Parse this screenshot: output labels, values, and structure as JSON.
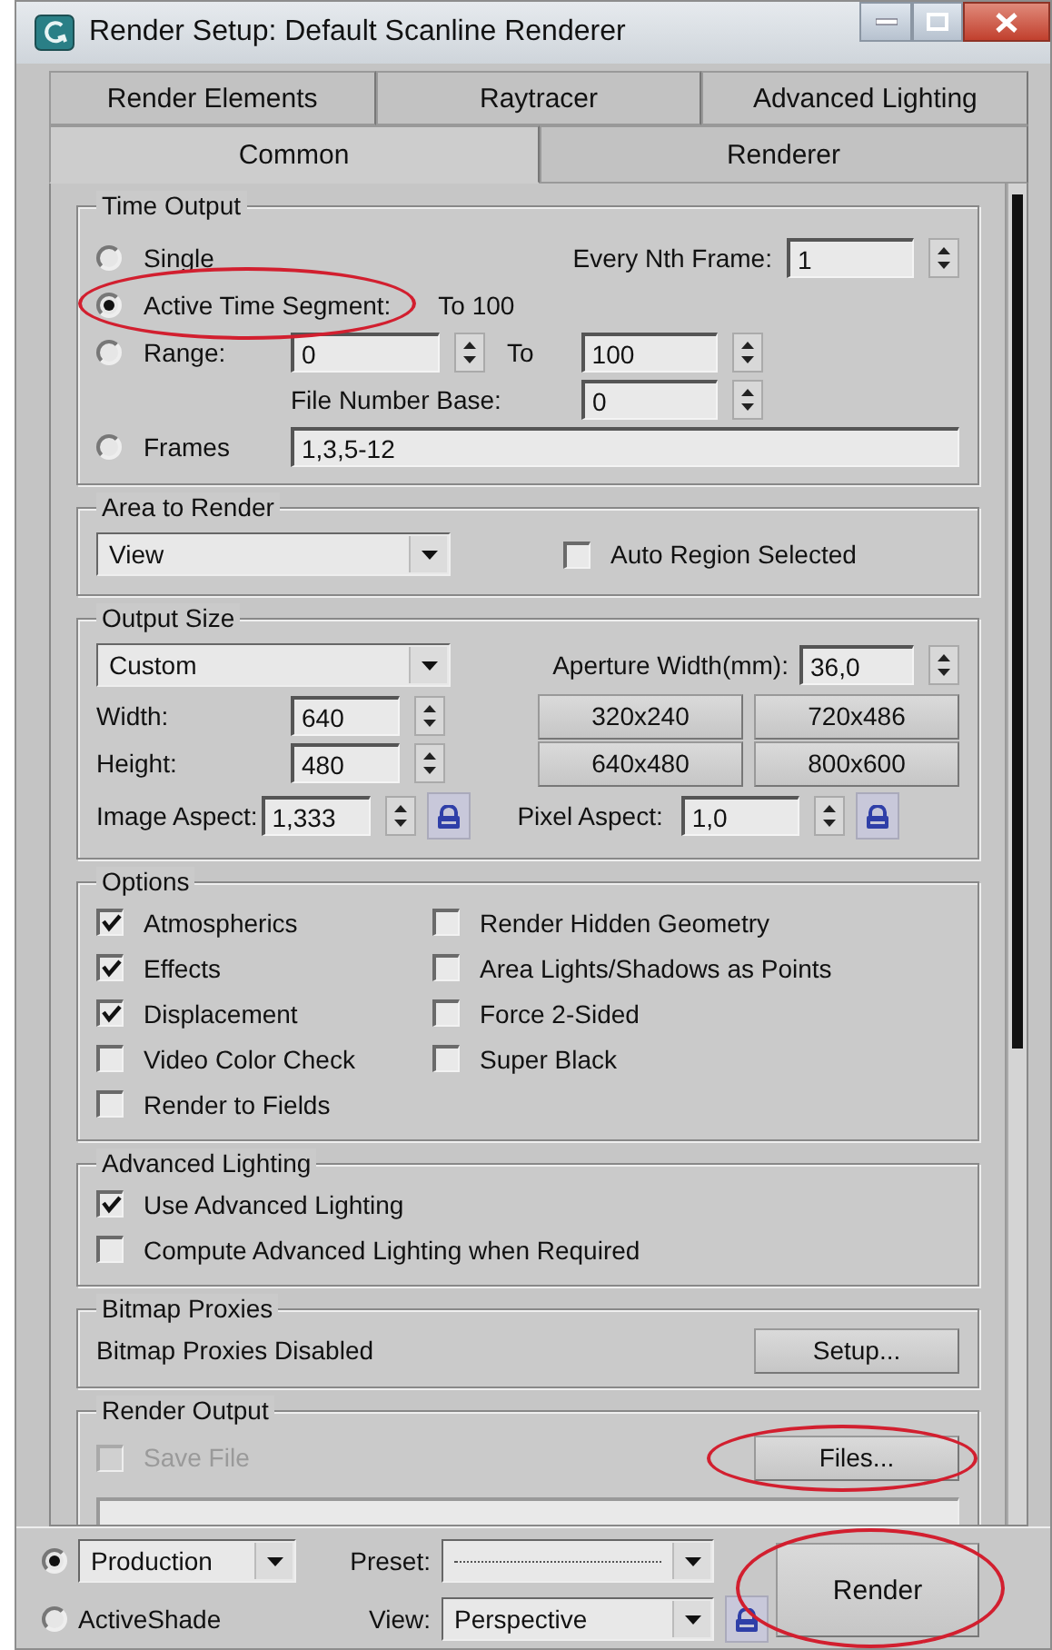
{
  "window": {
    "title": "Render Setup: Default Scanline Renderer"
  },
  "tab_rows": [
    {
      "tabs": [
        {
          "label": "Render Elements",
          "selected": false
        },
        {
          "label": "Raytracer",
          "selected": false
        },
        {
          "label": "Advanced Lighting",
          "selected": false
        }
      ]
    },
    {
      "tabs": [
        {
          "label": "Common",
          "selected": true
        },
        {
          "label": "Renderer",
          "selected": false
        }
      ]
    }
  ],
  "time_output": {
    "title": "Time Output",
    "single": {
      "label": "Single",
      "selected": false
    },
    "every_nth_frame": {
      "label": "Every Nth Frame:",
      "value": "1"
    },
    "active_time_segment": {
      "label": "Active Time Segment:",
      "selected": true,
      "highlighted": true,
      "range_text": "To 100"
    },
    "range": {
      "label": "Range:",
      "selected": false,
      "from": "0",
      "to_label": "To",
      "to": "100"
    },
    "file_number_base": {
      "label": "File Number Base:",
      "value": "0"
    },
    "frames": {
      "label": "Frames",
      "selected": false,
      "value": "1,3,5-12"
    }
  },
  "area_to_render": {
    "title": "Area to Render",
    "dropdown": "View",
    "auto_region_selected": {
      "label": "Auto Region Selected",
      "checked": false
    }
  },
  "output_size": {
    "title": "Output Size",
    "dropdown": "Custom",
    "aperture_width": {
      "label": "Aperture Width(mm):",
      "value": "36,0"
    },
    "width": {
      "label": "Width:",
      "value": "640"
    },
    "height": {
      "label": "Height:",
      "value": "480"
    },
    "presets": [
      "320x240",
      "720x486",
      "640x480",
      "800x600"
    ],
    "image_aspect": {
      "label": "Image Aspect:",
      "value": "1,333"
    },
    "pixel_aspect": {
      "label": "Pixel Aspect:",
      "value": "1,0"
    }
  },
  "options": {
    "title": "Options",
    "columns": [
      [
        {
          "label": "Atmospherics",
          "checked": true
        },
        {
          "label": "Effects",
          "checked": true
        },
        {
          "label": "Displacement",
          "checked": true
        },
        {
          "label": "Video Color Check",
          "checked": false
        },
        {
          "label": "Render to Fields",
          "checked": false
        }
      ],
      [
        {
          "label": "Render Hidden Geometry",
          "checked": false
        },
        {
          "label": "Area Lights/Shadows as Points",
          "checked": false
        },
        {
          "label": "Force 2-Sided",
          "checked": false
        },
        {
          "label": "Super Black",
          "checked": false
        }
      ]
    ]
  },
  "advanced_lighting": {
    "title": "Advanced Lighting",
    "items": [
      {
        "label": "Use Advanced Lighting",
        "checked": true
      },
      {
        "label": "Compute Advanced Lighting when Required",
        "checked": false
      }
    ]
  },
  "bitmap_proxies": {
    "title": "Bitmap Proxies",
    "status": "Bitmap Proxies Disabled",
    "button": "Setup..."
  },
  "render_output": {
    "title": "Render Output",
    "save_file": {
      "label": "Save File",
      "checked": false,
      "disabled": true
    },
    "files_button": {
      "label": "Files...",
      "highlighted": true
    }
  },
  "bottom_bar": {
    "modes": [
      {
        "kind": "dropdown",
        "value": "Production",
        "selected": true
      },
      {
        "kind": "label",
        "label": "ActiveShade",
        "selected": false
      }
    ],
    "preset_label": "Preset:",
    "view_label": "View:",
    "view": "Perspective",
    "render_button": {
      "label": "Render",
      "highlighted": true
    }
  }
}
